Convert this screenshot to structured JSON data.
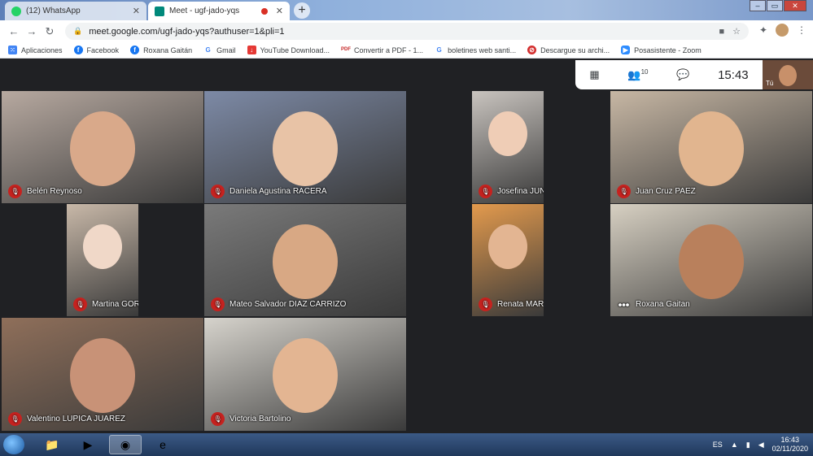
{
  "browser": {
    "tabs": [
      {
        "title": "(12) WhatsApp",
        "favicon": "whatsapp-icon",
        "active": false
      },
      {
        "title": "Meet - ugf-jado-yqs",
        "favicon": "meet-icon",
        "active": true
      }
    ],
    "url": "meet.google.com/ugf-jado-yqs?authuser=1&pli=1",
    "bookmarks": [
      {
        "label": "Aplicaciones",
        "icon": "apps-grid-icon"
      },
      {
        "label": "Facebook",
        "icon": "facebook-icon"
      },
      {
        "label": "Roxana Gaitán",
        "icon": "facebook-icon"
      },
      {
        "label": "Gmail",
        "icon": "google-icon"
      },
      {
        "label": "YouTube Download...",
        "icon": "bookmark-icon"
      },
      {
        "label": "Convertir a PDF - 1...",
        "icon": "pdf-icon"
      },
      {
        "label": "boletines web santi...",
        "icon": "google-icon"
      },
      {
        "label": "Descargue su archi...",
        "icon": "bookmark-icon"
      },
      {
        "label": "Posasistente - Zoom",
        "icon": "zoom-icon"
      }
    ]
  },
  "meet": {
    "clock": "15:43",
    "participant_count": "10",
    "self_label": "Tú",
    "participants": [
      {
        "name": "Belén Reynoso",
        "muted": true,
        "bg": "#b7a9a0",
        "face": "#d9a98a"
      },
      {
        "name": "Daniela Agustina RACERA",
        "muted": true,
        "bg": "#7d8aa6",
        "face": "#e8c3a6"
      },
      {
        "name": "Josefina JUNCO DEL RIO",
        "muted": true,
        "bg": "#c9c4bf",
        "face": "#efcdb6"
      },
      {
        "name": "Juan Cruz PAEZ",
        "muted": true,
        "bg": "#c7b7a4",
        "face": "#e1b58f"
      },
      {
        "name": "Martina GORDILLO CERVANTES",
        "muted": true,
        "bg": "#c8b8a8",
        "face": "#f0d8c8"
      },
      {
        "name": "Mateo Salvador DIAZ CARRIZO",
        "muted": true,
        "bg": "#7a7a7a",
        "face": "#d8a884"
      },
      {
        "name": "Renata MARTINEZ SUAREZ",
        "muted": true,
        "bg": "#e39a4d",
        "face": "#e3b592"
      },
      {
        "name": "Roxana Gaitan",
        "muted": false,
        "bg": "#d7d0c2",
        "face": "#b9805c"
      },
      {
        "name": "Valentino LUPICA JUAREZ",
        "muted": true,
        "bg": "#8f6f5a",
        "face": "#c89277"
      },
      {
        "name": "Victoria Bartolino",
        "muted": true,
        "bg": "#d6d3cc",
        "face": "#e3b592"
      }
    ]
  },
  "taskbar": {
    "language": "ES",
    "time": "16:43",
    "date": "02/11/2020"
  },
  "colors": {
    "mute_red": "#c5221f",
    "meet_bg": "#202124"
  }
}
